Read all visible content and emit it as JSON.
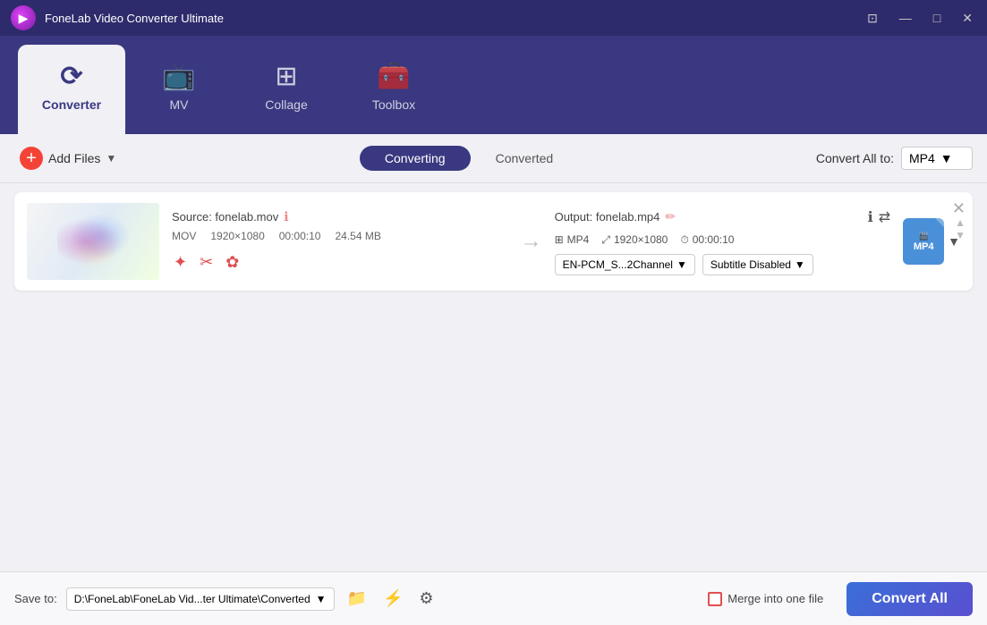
{
  "app": {
    "title": "FoneLab Video Converter Ultimate",
    "logo_char": "▶"
  },
  "titlebar_controls": {
    "captions": "⊡",
    "minimize": "—",
    "maximize": "□",
    "close": "✕"
  },
  "tabs": [
    {
      "id": "converter",
      "label": "Converter",
      "icon": "⟳",
      "active": true
    },
    {
      "id": "mv",
      "label": "MV",
      "icon": "📺"
    },
    {
      "id": "collage",
      "label": "Collage",
      "icon": "⊞"
    },
    {
      "id": "toolbox",
      "label": "Toolbox",
      "icon": "🧰"
    }
  ],
  "toolbar": {
    "add_files_label": "Add Files",
    "converting_label": "Converting",
    "converted_label": "Converted",
    "convert_all_to_label": "Convert All to:",
    "format": "MP4"
  },
  "file_item": {
    "source_label": "Source: fonelab.mov",
    "format": "MOV",
    "resolution": "1920×1080",
    "duration": "00:00:10",
    "size": "24.54 MB",
    "output_label": "Output: fonelab.mp4",
    "output_format": "MP4",
    "output_resolution": "1920×1080",
    "output_duration": "00:00:10",
    "audio_dropdown": "EN-PCM_S...2Channel",
    "subtitle_dropdown": "Subtitle Disabled",
    "badge_format": "MP4"
  },
  "bottombar": {
    "save_to_label": "Save to:",
    "save_path": "D:\\FoneLab\\FoneLab Vid...ter Ultimate\\Converted",
    "merge_label": "Merge into one file",
    "convert_all_label": "Convert All"
  }
}
